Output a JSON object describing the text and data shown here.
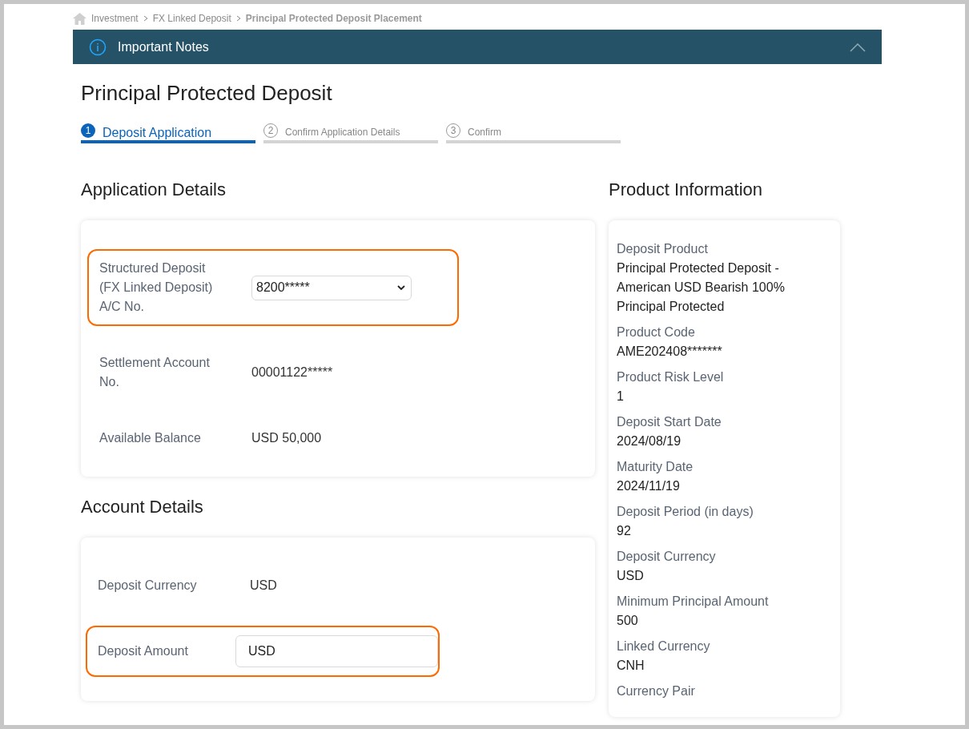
{
  "breadcrumb": [
    {
      "label": "Investment",
      "current": false
    },
    {
      "label": "FX Linked Deposit",
      "current": false
    },
    {
      "label": "Principal Protected Deposit Placement",
      "current": true
    }
  ],
  "banner": {
    "title": "Important Notes",
    "expanded": false
  },
  "page_title": "Principal Protected Deposit",
  "steps": [
    {
      "number": "1",
      "label": "Deposit Application",
      "selected": true
    },
    {
      "number": "2",
      "label": "Confirm Application Details",
      "selected": false
    },
    {
      "number": "3",
      "label": "Confirm",
      "selected": false
    }
  ],
  "application_details": {
    "title": "Application Details",
    "rows": [
      {
        "kind": "select",
        "label": "Structured Deposit (FX Linked Deposit) A/C No.",
        "value": "8200*****",
        "highlighted": true
      },
      {
        "kind": "text",
        "label": "Settlement Account No.",
        "value": "00001122*****",
        "highlighted": false
      },
      {
        "kind": "text",
        "label": "Available Balance",
        "value": "USD 50,000",
        "highlighted": false
      }
    ]
  },
  "account_details": {
    "title": "Account Details",
    "rows": [
      {
        "kind": "text",
        "label": "Deposit Currency",
        "value": "USD",
        "highlighted": false
      },
      {
        "kind": "input",
        "label": "Deposit Amount",
        "value": "USD",
        "highlighted": true
      }
    ]
  },
  "product_information": {
    "title": "Product Information",
    "items": [
      {
        "label": "Deposit Product",
        "value": "Principal Protected Deposit - American USD Bearish 100% Principal Protected"
      },
      {
        "label": "Product Code",
        "value": "AME202408*******"
      },
      {
        "label": "Product Risk Level",
        "value": "1"
      },
      {
        "label": "Deposit Start Date",
        "value": "2024/08/19"
      },
      {
        "label": "Maturity Date",
        "value": "2024/11/19"
      },
      {
        "label": "Deposit Period (in days)",
        "value": "92"
      },
      {
        "label": "Deposit Currency",
        "value": "USD"
      },
      {
        "label": "Minimum Principal Amount",
        "value": "500"
      },
      {
        "label": "Linked Currency",
        "value": "CNH"
      },
      {
        "label": "Currency Pair"
      }
    ]
  }
}
